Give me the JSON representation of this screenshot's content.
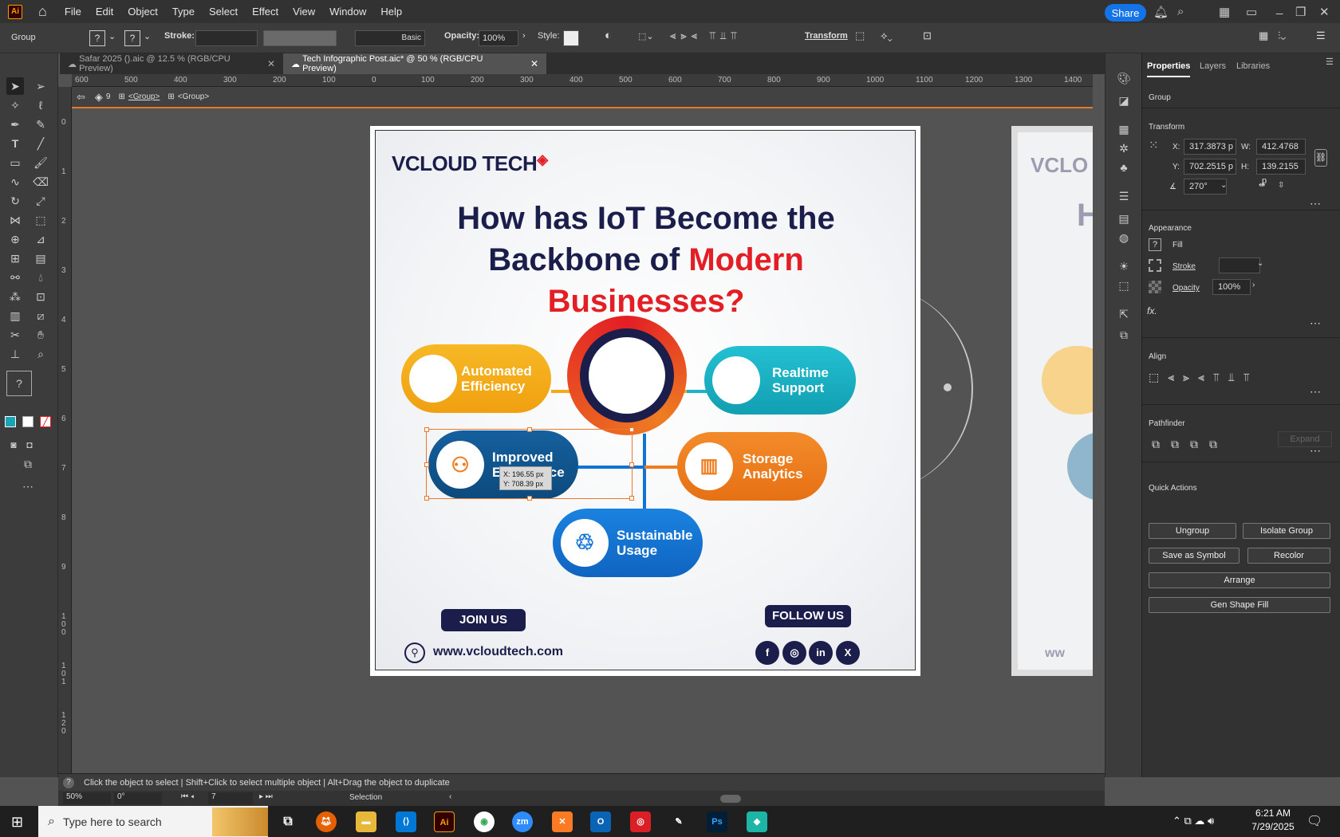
{
  "app": {
    "logo": "Ai",
    "menus": [
      "File",
      "Edit",
      "Object",
      "Type",
      "Select",
      "Effect",
      "View",
      "Window",
      "Help"
    ],
    "share": "Share"
  },
  "control": {
    "selection_label": "Group",
    "stroke_label": "Stroke:",
    "stroke_style": "Basic",
    "opacity_label": "Opacity:",
    "opacity_value": "100%",
    "style_label": "Style:",
    "transform_label": "Transform"
  },
  "tabs": [
    {
      "label": "Safar 2025 ().aic @ 12.5 % (RGB/CPU Preview)"
    },
    {
      "label": "Tech Infographic Post.aic* @ 50 % (RGB/CPU Preview)"
    }
  ],
  "ruler_h": [
    "600",
    "500",
    "400",
    "300",
    "200",
    "100",
    "0",
    "100",
    "200",
    "300",
    "400",
    "500",
    "600",
    "700",
    "800",
    "900",
    "1000",
    "1100",
    "1200",
    "1300",
    "1400"
  ],
  "ruler_v": [
    "0",
    "1",
    "2",
    "3",
    "4",
    "5",
    "6",
    "7",
    "8",
    "9",
    "1 0 0",
    "1 0 1",
    "1 2 0"
  ],
  "breadcrumb": {
    "layer_num": "9",
    "group1": "<Group>",
    "group2": "<Group>"
  },
  "art": {
    "brand": "VCLOUD TECH",
    "title_line1": "How has IoT Become the",
    "title_line2a": "Backbone of ",
    "title_line2b": "Modern",
    "title_line3": "Businesses?",
    "pills": {
      "automated": "Automated\nEfficiency",
      "realtime": "Realtime\nSupport",
      "improved": "Improved\nExperience",
      "storage": "Storage\nAnalytics",
      "sustainable": "Sustainable\nUsage"
    },
    "tooltip_x": "X: 196.55 px",
    "tooltip_y": "Y: 708.39 px",
    "join": "JOIN US",
    "follow": "FOLLOW US",
    "url": "www.vcloudtech.com",
    "social": [
      "f",
      "◎",
      "in",
      "X"
    ],
    "colors": {
      "navy": "#1b1e4b",
      "red": "#e31e24",
      "orange": "#ee7d22",
      "yellow": "#f6a917",
      "teal": "#1bb3c5",
      "blue": "#1173d4",
      "darkblue": "#0f4f86"
    }
  },
  "art2": {
    "brand_partial": "VCLO",
    "title_partial": "H",
    "url_partial": "ww"
  },
  "panel": {
    "tabs": [
      "Properties",
      "Layers",
      "Libraries"
    ],
    "group_label": "Group",
    "transform": {
      "title": "Transform",
      "x_label": "X:",
      "x": "317.3873 p",
      "y_label": "Y:",
      "y": "702.2515 p",
      "w_label": "W:",
      "w": "412.4768 p",
      "h_label": "H:",
      "h": "139.2155 p",
      "angle": "270°"
    },
    "appearance": {
      "title": "Appearance",
      "fill": "Fill",
      "stroke": "Stroke",
      "opacity": "Opacity",
      "opacity_value": "100%",
      "fx": "fx."
    },
    "align": {
      "title": "Align"
    },
    "pathfinder": {
      "title": "Pathfinder",
      "expand": "Expand"
    },
    "quick": {
      "title": "Quick Actions",
      "ungroup": "Ungroup",
      "isolate": "Isolate Group",
      "save_symbol": "Save as Symbol",
      "recolor": "Recolor",
      "arrange": "Arrange",
      "gen_shape": "Gen Shape Fill"
    }
  },
  "status": {
    "hint": "Click the object to select  |  Shift+Click to select multiple object  |  Alt+Drag the object to duplicate",
    "zoom": "50%",
    "rotate": "0°",
    "artboard": "7",
    "tool": "Selection"
  },
  "taskbar": {
    "search": "Type here to search",
    "time": "6:21 AM",
    "date": "7/29/2025"
  }
}
